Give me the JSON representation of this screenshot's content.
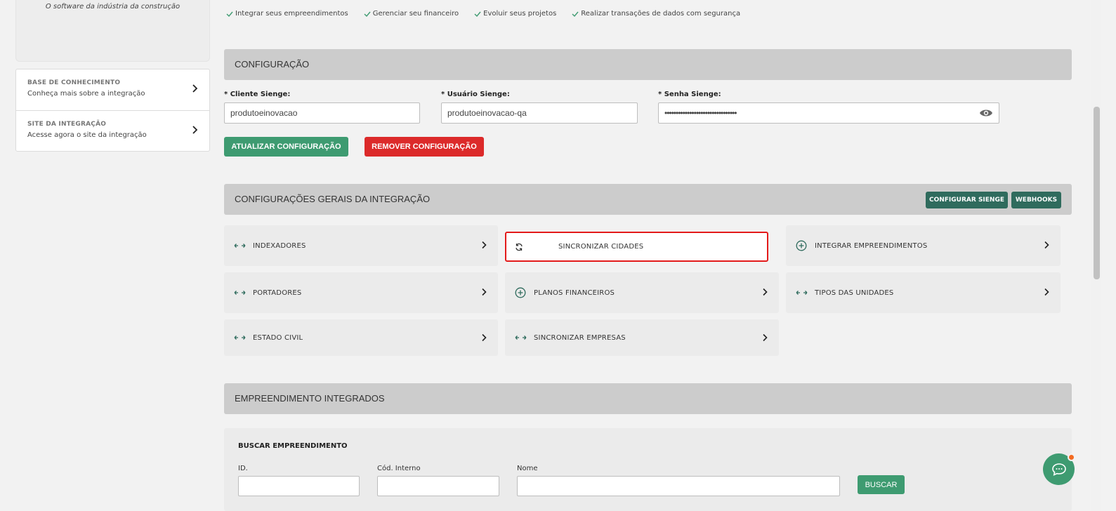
{
  "sidebar": {
    "tagline": "O software da indústria da construção",
    "links": [
      {
        "title": "BASE DE CONHECIMENTO",
        "subtitle": "Conheça mais sobre a integração"
      },
      {
        "title": "SITE DA INTEGRAÇÃO",
        "subtitle": "Acesse agora o site da integração"
      }
    ]
  },
  "benefits": [
    "Integrar seus empreendimentos",
    "Gerenciar seu financeiro",
    "Evoluir seus projetos",
    "Realizar transações de dados com segurança"
  ],
  "config": {
    "title": "CONFIGURAÇÃO",
    "cliente_label": "* Cliente Sienge:",
    "cliente_value": "produtoeinovacao",
    "usuario_label": "* Usuário Sienge:",
    "usuario_value": "produtoeinovacao-qa",
    "senha_label": "* Senha Sienge:",
    "senha_value": "••••••••••••••••••••••••••••••••",
    "update_label": "ATUALIZAR CONFIGURAÇÃO",
    "remove_label": "REMOVER CONFIGURAÇÃO"
  },
  "general": {
    "title": "CONFIGURAÇÕES GERAIS DA INTEGRAÇÃO",
    "config_sienge_label": "CONFIGURAR SIENGE",
    "webhooks_label": "WEBHOOKS",
    "cards": [
      {
        "label": "INDEXADORES",
        "icon": "arrows-icon"
      },
      {
        "label": "SINCRONIZAR CIDADES",
        "icon": "sync-icon"
      },
      {
        "label": "INTEGRAR EMPREENDIMENTOS",
        "icon": "plus-circle-icon"
      },
      {
        "label": "PORTADORES",
        "icon": "arrows-icon"
      },
      {
        "label": "PLANOS FINANCEIROS",
        "icon": "plus-circle-icon"
      },
      {
        "label": "TIPOS DAS UNIDADES",
        "icon": "arrows-icon"
      },
      {
        "label": "ESTADO CIVIL",
        "icon": "arrows-icon"
      },
      {
        "label": "SINCRONIZAR EMPRESAS",
        "icon": "arrows-icon"
      }
    ]
  },
  "integrated": {
    "title": "EMPREENDIMENTO INTEGRADOS",
    "search_title": "BUSCAR EMPREENDIMENTO",
    "id_label": "ID.",
    "cod_label": "Cód. Interno",
    "nome_label": "Nome",
    "search_button": "BUSCAR"
  },
  "colors": {
    "accent": "#3e9b71",
    "danger": "#dc2a2a",
    "dark_green": "#2f6b5d",
    "highlight": "#e31b1b",
    "badge": "#f36b21"
  }
}
